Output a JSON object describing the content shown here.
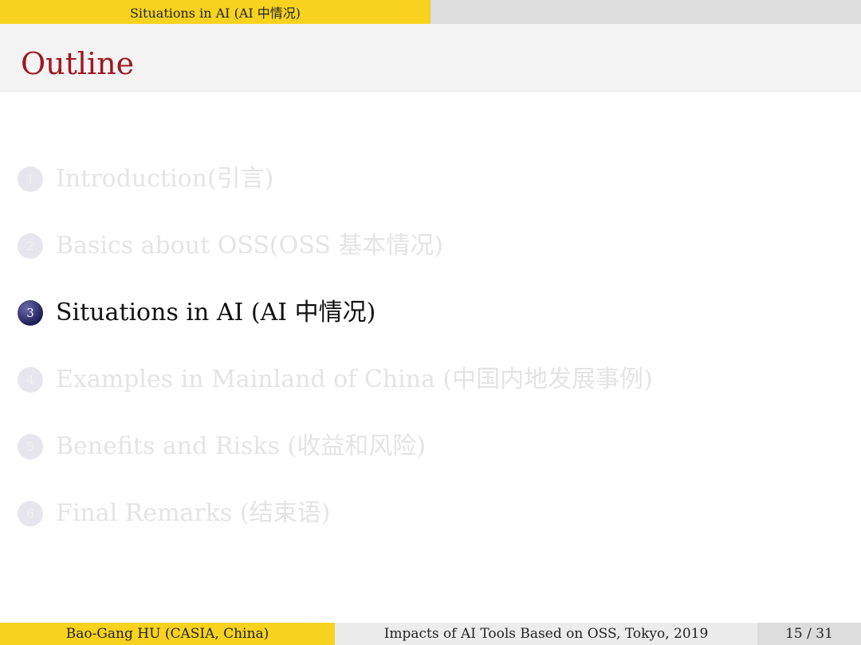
{
  "header": {
    "section_title": "Situations in AI (AI 中情况)"
  },
  "slide": {
    "title": "Outline"
  },
  "outline": {
    "items": [
      {
        "number": "1",
        "label": "Introduction(引言)",
        "active": false
      },
      {
        "number": "2",
        "label": "Basics about OSS(OSS 基本情况)",
        "active": false
      },
      {
        "number": "3",
        "label": "Situations in AI (AI 中情况)",
        "active": true
      },
      {
        "number": "4",
        "label": "Examples in Mainland of China (中国内地发展事例)",
        "active": false
      },
      {
        "number": "5",
        "label": "Benefits and Risks (收益和风险)",
        "active": false
      },
      {
        "number": "6",
        "label": "Final Remarks (结束语)",
        "active": false
      }
    ]
  },
  "footer": {
    "author": "Bao-Gang HU (CASIA, China)",
    "talk_title": "Impacts of AI Tools Based on OSS, Tokyo, 2019",
    "page": "15 / 31"
  },
  "colors": {
    "accent_yellow": "#f7d21e",
    "title_red": "#a01820",
    "bullet_active": "#1e1e5a"
  }
}
